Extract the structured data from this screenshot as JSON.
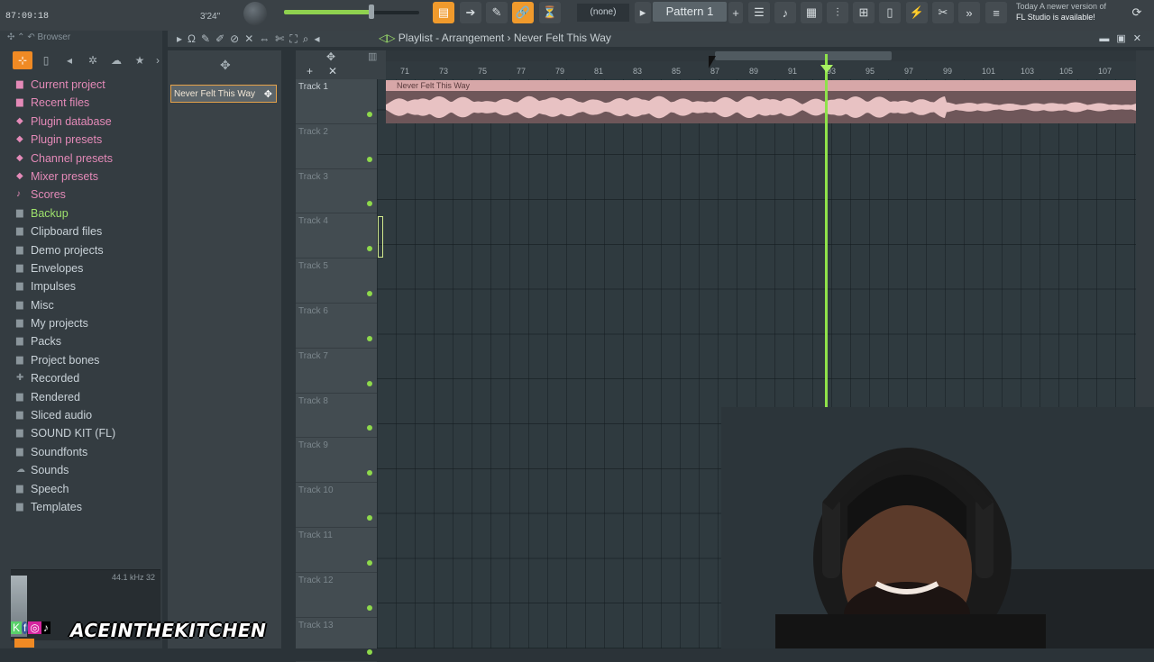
{
  "topbar": {
    "time": "87:09:18",
    "tempo": "3'24\"",
    "pattern_none": "(none)",
    "pattern": "Pattern 1",
    "news_line1": "Today  A newer version of",
    "news_line2": "FL Studio is available!"
  },
  "browser": {
    "title": "Browser",
    "items": [
      {
        "label": "Current project",
        "color": "pink",
        "icon": "folder-icon"
      },
      {
        "label": "Recent files",
        "color": "pink",
        "icon": "folder-icon"
      },
      {
        "label": "Plugin database",
        "color": "pink",
        "icon": "plug-icon"
      },
      {
        "label": "Plugin presets",
        "color": "pink",
        "icon": "plug-icon"
      },
      {
        "label": "Channel presets",
        "color": "pink",
        "icon": "plug-icon"
      },
      {
        "label": "Mixer presets",
        "color": "pink",
        "icon": "plug-icon"
      },
      {
        "label": "Scores",
        "color": "pink",
        "icon": "note-icon"
      },
      {
        "label": "Backup",
        "color": "green",
        "icon": "folder-icon"
      },
      {
        "label": "Clipboard files",
        "color": "normal",
        "icon": "folder-icon"
      },
      {
        "label": "Demo projects",
        "color": "normal",
        "icon": "folder-icon"
      },
      {
        "label": "Envelopes",
        "color": "normal",
        "icon": "folder-icon"
      },
      {
        "label": "Impulses",
        "color": "normal",
        "icon": "folder-icon"
      },
      {
        "label": "Misc",
        "color": "normal",
        "icon": "folder-icon"
      },
      {
        "label": "My projects",
        "color": "normal",
        "icon": "folder-icon"
      },
      {
        "label": "Packs",
        "color": "normal",
        "icon": "folder-icon"
      },
      {
        "label": "Project bones",
        "color": "normal",
        "icon": "folder-icon"
      },
      {
        "label": "Recorded",
        "color": "normal",
        "icon": "plus-icon"
      },
      {
        "label": "Rendered",
        "color": "normal",
        "icon": "folder-icon"
      },
      {
        "label": "Sliced audio",
        "color": "normal",
        "icon": "folder-icon"
      },
      {
        "label": "SOUND KIT (FL)",
        "color": "normal",
        "icon": "folder-icon"
      },
      {
        "label": "Soundfonts",
        "color": "normal",
        "icon": "folder-icon"
      },
      {
        "label": "Sounds",
        "color": "normal",
        "icon": "cloud-icon"
      },
      {
        "label": "Speech",
        "color": "normal",
        "icon": "folder-icon"
      },
      {
        "label": "Templates",
        "color": "normal",
        "icon": "folder-icon"
      }
    ],
    "preview_rate": "44.1 kHz 32"
  },
  "picker": {
    "pattern_name": "Never Felt This Way"
  },
  "playlist": {
    "title_prefix": "Playlist - Arrangement",
    "title_sep": "›",
    "project_name": "Never Felt This Way",
    "ruler_ticks": [
      "71",
      "73",
      "75",
      "77",
      "79",
      "81",
      "83",
      "85",
      "87",
      "89",
      "91",
      "93",
      "95",
      "97",
      "99",
      "101",
      "103",
      "105",
      "107"
    ],
    "tracks": [
      "Track 1",
      "Track 2",
      "Track 3",
      "Track 4",
      "Track 5",
      "Track 6",
      "Track 7",
      "Track 8",
      "Track 9",
      "Track 10",
      "Track 11",
      "Track 12",
      "Track 13"
    ],
    "clip_label": "Never Felt This Way"
  },
  "watermark": {
    "text": "ACEINTHEKITCHEN"
  },
  "colors": {
    "accent": "#f09a2c",
    "playhead": "#8fe24a",
    "clip": "#d7a7a8"
  }
}
